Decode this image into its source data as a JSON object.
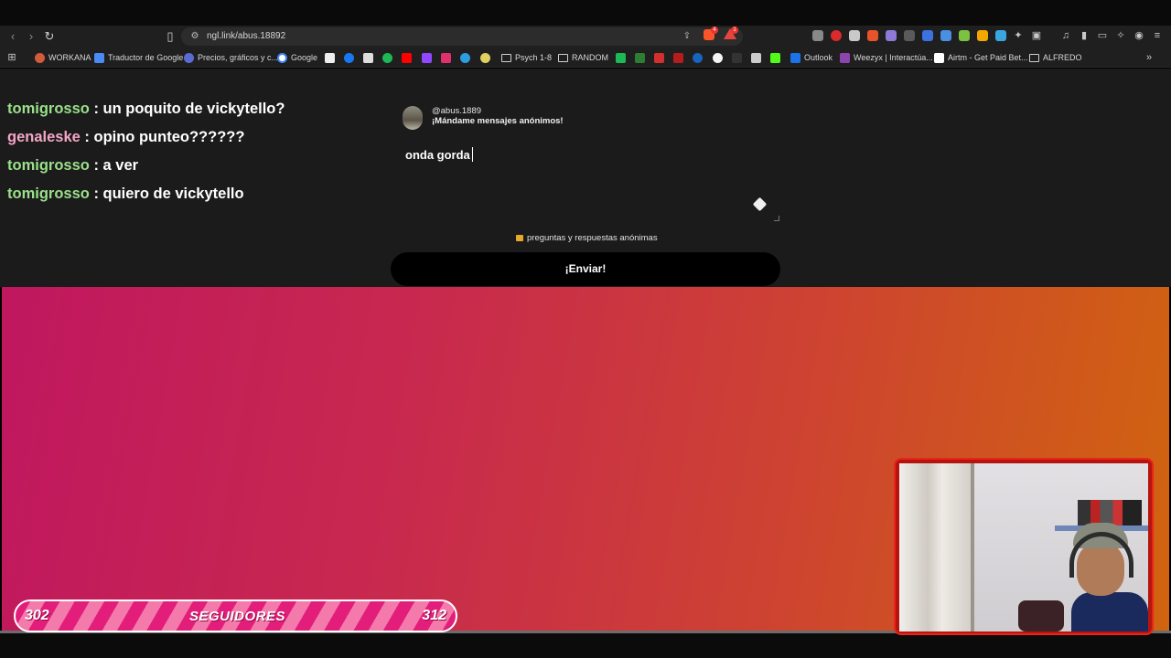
{
  "browser": {
    "url": "ngl.link/abus.18892",
    "brave_badge_count": "4",
    "alert_badge_count": "1",
    "bookmarks": [
      {
        "label": "WORKANA",
        "color": "#d35b3c"
      },
      {
        "label": "Traductor de Google",
        "color": "#4a8af4"
      },
      {
        "label": "Precios, gráficos y c...",
        "color": "#5b6bd4"
      },
      {
        "label": "Google",
        "color": "#4285f4"
      },
      {
        "label": "Psych 1-8",
        "color": "folder"
      },
      {
        "label": "RANDOM",
        "color": "folder"
      },
      {
        "label": "Outlook",
        "color": "#1a73e8"
      },
      {
        "label": "Weezyx | Interactúa...",
        "color": "#8e44ad"
      },
      {
        "label": "Airtm - Get Paid Bet...",
        "color": "#ffffff"
      },
      {
        "label": "ALFREDO",
        "color": "folder"
      }
    ],
    "bookmark_icon_names": [
      "tiktok-icon",
      "facebook-icon",
      "x-icon",
      "spotify-icon",
      "youtube-icon",
      "twitch-icon",
      "instagram-icon",
      "bookmark-icon",
      "bookmark-icon"
    ]
  },
  "chat": [
    {
      "user": "tomigrosso",
      "user_color": "#9be08a",
      "message": ": un poquito de vickytello?"
    },
    {
      "user": "genaleske",
      "user_color": "#f4a6c8",
      "message": ": opino punteo??????"
    },
    {
      "user": "tomigrosso",
      "user_color": "#9be08a",
      "message": ": a ver"
    },
    {
      "user": "tomigrosso",
      "user_color": "#9be08a",
      "message": ": quiero de vickytello"
    }
  ],
  "ngl": {
    "handle": "@abus.1889",
    "prompt": "¡Mándame mensajes anónimos!",
    "message_value": "onda gorda",
    "privacy_note": "preguntas y respuestas anónimas",
    "send_label": "¡Enviar!"
  },
  "followers": {
    "current": "302",
    "label": "SEGUIDORES",
    "goal": "312",
    "progress": 0
  }
}
